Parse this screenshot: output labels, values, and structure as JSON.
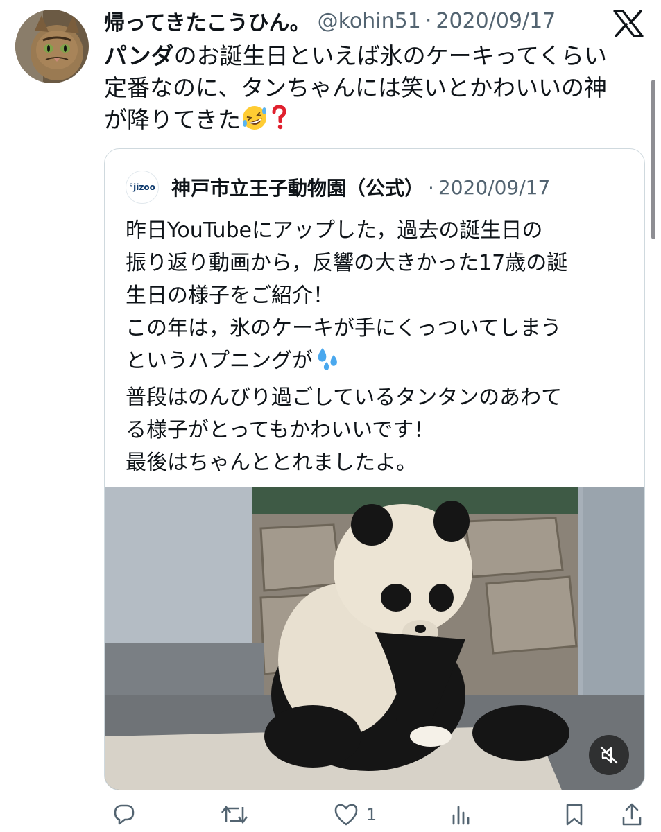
{
  "tweet": {
    "author_name": "帰ってきたこうひん。",
    "handle": "@kohin51",
    "separator": "·",
    "date": "2020/09/17",
    "text_bold": "パンダ",
    "text_body": "のお誕生日といえば氷のケーキってくらい\n定番なのに、タンちゃんには笑いとかわいいの神\nが降りてきた"
  },
  "quote": {
    "author_name": "神戸市立王子動物園（公式）",
    "avatar_text": "°jizoo",
    "separator": "·",
    "date": "2020/09/17",
    "text_part1": "昨日YouTubeにアップした，過去の誕生日の\n振り返り動画から，反響の大きかった17歳の誕\n生日の様子をご紹介！\nこの年は，氷のケーキが手にくっついてしまう\nというハプニングが",
    "text_part2": "\n普段はのんびり過ごしているタンタンのあわて\nる様子がとってもかわいいです！\n最後はちゃんととれましたよ。"
  },
  "actions": {
    "like_count": "1"
  },
  "icons": {
    "x_logo": "x-logo-icon",
    "mute": "muted-speaker-icon",
    "reply": "reply-icon",
    "retweet": "retweet-icon",
    "like": "heart-icon",
    "views": "views-icon",
    "bookmark": "bookmark-icon",
    "share": "share-icon"
  },
  "colors": {
    "text": "#0f1419",
    "secondary": "#536471",
    "border": "#cfd9de"
  }
}
